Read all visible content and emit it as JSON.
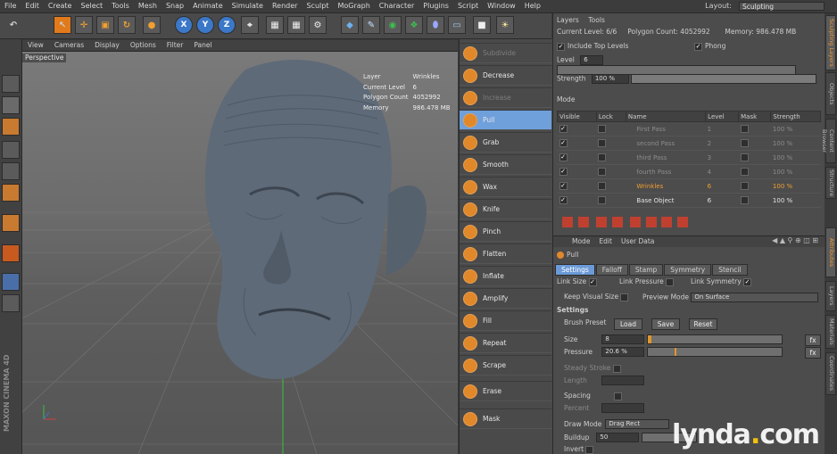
{
  "menubar": {
    "items": [
      "File",
      "Edit",
      "Create",
      "Select",
      "Tools",
      "Mesh",
      "Snap",
      "Animate",
      "Simulate",
      "Render",
      "Sculpt",
      "MoGraph",
      "Character",
      "Plugins",
      "Script",
      "Window",
      "Help"
    ],
    "layout_label": "Layout:",
    "layout_value": "Sculpting"
  },
  "toolbar": {
    "axis_x": "X",
    "axis_y": "Y",
    "axis_z": "Z"
  },
  "viewport": {
    "menu": [
      "View",
      "Cameras",
      "Display",
      "Options",
      "Filter",
      "Panel"
    ],
    "camera_label": "Perspective",
    "hud": {
      "layer_label": "Layer",
      "layer_value": "Wrinkles",
      "level_label": "Current Level",
      "level_value": "6",
      "poly_label": "Polygon Count",
      "poly_value": "4052992",
      "mem_label": "Memory",
      "mem_value": "986.478 MB"
    },
    "maxon": "MAXON CINEMA 4D"
  },
  "brushes": [
    {
      "label": "Subdivide",
      "dim": true
    },
    {
      "label": "Decrease",
      "dim": false
    },
    {
      "label": "Increase",
      "dim": true
    },
    {
      "label": "Pull",
      "dim": false
    },
    {
      "label": "Grab",
      "dim": false
    },
    {
      "label": "Smooth",
      "dim": false
    },
    {
      "label": "Wax",
      "dim": false
    },
    {
      "label": "Knife",
      "dim": false
    },
    {
      "label": "Pinch",
      "dim": false
    },
    {
      "label": "Flatten",
      "dim": false
    },
    {
      "label": "Inflate",
      "dim": false
    },
    {
      "label": "Amplify",
      "dim": false
    },
    {
      "label": "Fill",
      "dim": false
    },
    {
      "label": "Repeat",
      "dim": false
    },
    {
      "label": "Scrape",
      "dim": false
    },
    {
      "label": "Erase",
      "dim": false
    },
    {
      "label": "Mask",
      "dim": false
    }
  ],
  "layers_panel": {
    "tabs": [
      "Layers",
      "Tools"
    ],
    "current_level": "Current Level: 6/6",
    "polygon_count": "Polygon Count: 4052992",
    "memory": "Memory: 986.478 MB",
    "include_top_levels": "Include Top Levels",
    "phong": "Phong",
    "level_label": "Level",
    "level_value": "6",
    "strength_label": "Strength",
    "strength_value": "100 %",
    "mode_label": "Mode",
    "columns": [
      "Visible",
      "Lock",
      "Name",
      "Level",
      "Mask",
      "Strength"
    ],
    "rows": [
      {
        "name": "First Pass",
        "level": "1",
        "strength": "100 %",
        "cls": ""
      },
      {
        "name": "second Pass",
        "level": "2",
        "strength": "100 %",
        "cls": ""
      },
      {
        "name": "third Pass",
        "level": "3",
        "strength": "100 %",
        "cls": ""
      },
      {
        "name": "fourth Pass",
        "level": "4",
        "strength": "100 %",
        "cls": ""
      },
      {
        "name": "Wrinkles",
        "level": "6",
        "strength": "100 %",
        "cls": "hi"
      },
      {
        "name": "Base Object",
        "level": "6",
        "strength": "100 %",
        "cls": "active"
      }
    ]
  },
  "attributes": {
    "menu": [
      "Mode",
      "Edit",
      "User Data"
    ],
    "tool_name": "Pull",
    "subtabs": [
      "Settings",
      "Falloff",
      "Stamp",
      "Symmetry",
      "Stencil"
    ],
    "link_size": "Link Size",
    "link_pressure": "Link Pressure",
    "link_symmetry": "Link Symmetry",
    "keep_visual_size": "Keep Visual Size",
    "preview_mode_label": "Preview Mode",
    "preview_mode_value": "On Surface",
    "settings_header": "Settings",
    "brush_preset": "Brush Preset",
    "load": "Load",
    "save": "Save",
    "reset": "Reset",
    "size_label": "Size",
    "size_value": "8",
    "pressure_label": "Pressure",
    "pressure_value": "20.6 %",
    "steady_stroke": "Steady Stroke",
    "length_label": "Length",
    "spacing_label": "Spacing",
    "percent_label": "Percent",
    "draw_mode_label": "Draw Mode",
    "draw_mode_value": "Drag Rect",
    "buildup_label": "Buildup",
    "buildup_value": "50",
    "invert_label": "Invert",
    "fx": "fx"
  },
  "side_tabs": [
    "Sculpting Layers",
    "Objects",
    "Content Browser",
    "Structure",
    "Attributes",
    "Layers",
    "Materials",
    "Coordinates"
  ],
  "watermark": {
    "text_a": "lynda",
    "dot": ".",
    "text_b": "com"
  }
}
